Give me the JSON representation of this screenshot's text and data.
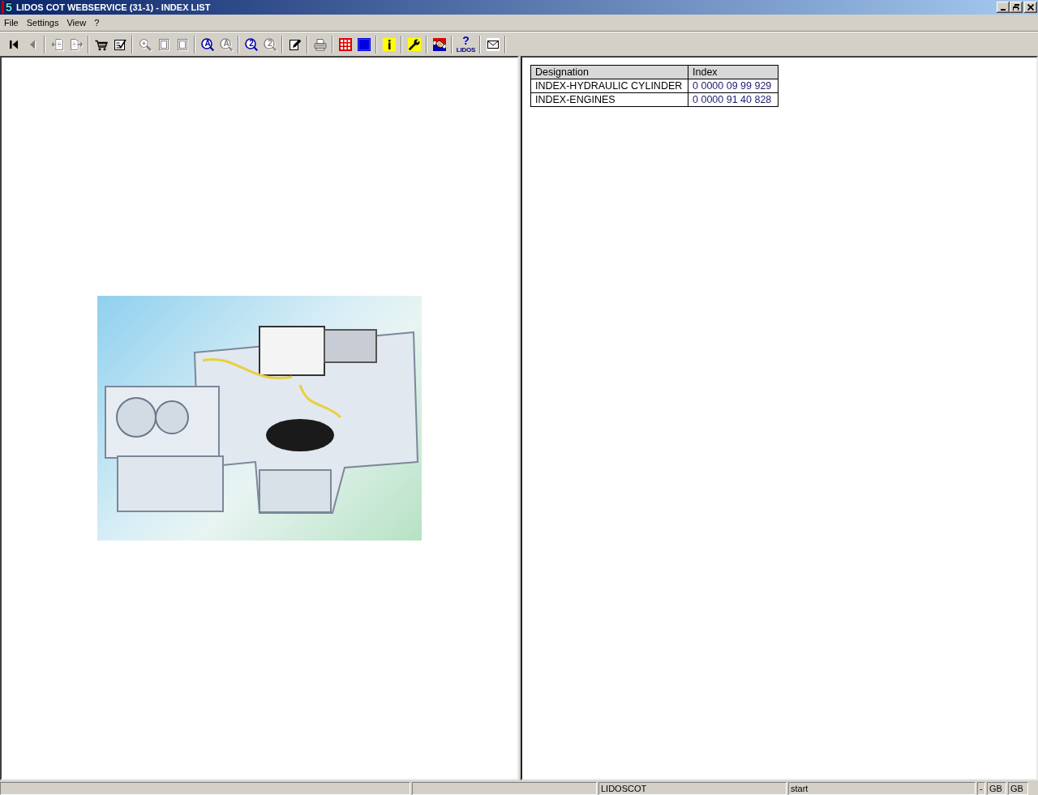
{
  "window": {
    "logo": "5",
    "title": "LIDOS COT WEBSERVICE (31-1) - INDEX LIST"
  },
  "menu": [
    "File",
    "Settings",
    "View",
    "?"
  ],
  "toolbar": [
    [
      {
        "kind": "first",
        "disabled": false
      },
      {
        "kind": "previous",
        "disabled": true
      }
    ],
    [
      {
        "kind": "doc_back",
        "disabled": true
      },
      {
        "kind": "doc_forward",
        "disabled": true
      }
    ],
    [
      {
        "kind": "cart",
        "disabled": false
      },
      {
        "kind": "checklist",
        "disabled": false
      }
    ],
    [
      {
        "kind": "zoom",
        "disabled": true
      },
      {
        "kind": "page",
        "disabled": true
      },
      {
        "kind": "page",
        "disabled": true
      }
    ],
    [
      {
        "kind": "find",
        "label": "A",
        "disabled": false
      },
      {
        "kind": "find",
        "label": "A",
        "disabled": true
      }
    ],
    [
      {
        "kind": "find",
        "label": "2",
        "disabled": false
      },
      {
        "kind": "find",
        "label": "2",
        "disabled": true
      }
    ],
    [
      {
        "kind": "edit",
        "disabled": false
      }
    ],
    [
      {
        "kind": "print",
        "disabled": false
      }
    ],
    [
      {
        "kind": "grid",
        "disabled": false
      },
      {
        "kind": "square",
        "disabled": false
      }
    ],
    [
      {
        "kind": "info",
        "disabled": false
      }
    ],
    [
      {
        "kind": "tools",
        "disabled": false
      }
    ],
    [
      {
        "kind": "handshake",
        "disabled": false
      }
    ],
    [
      {
        "kind": "help",
        "label": "?",
        "caption": "LIDOS",
        "disabled": false
      }
    ],
    [
      {
        "kind": "mail",
        "disabled": false
      }
    ]
  ],
  "index_table": {
    "columns": [
      "Designation",
      "Index"
    ],
    "rows": [
      [
        "INDEX-HYDRAULIC CYLINDER",
        "0 0000 09 99 929"
      ],
      [
        "INDEX-ENGINES",
        "0 0000 91 40 828"
      ]
    ]
  },
  "status_bar": [
    "LIDOSCOT",
    "start",
    "-",
    "GB",
    "GB"
  ]
}
